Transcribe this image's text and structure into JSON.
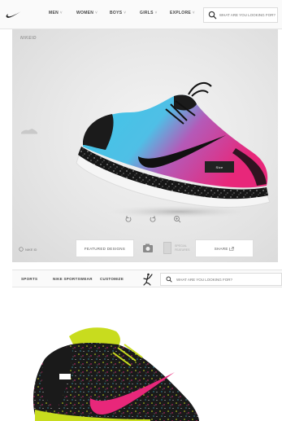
{
  "nav": {
    "items": [
      {
        "label": "MEN"
      },
      {
        "label": "WOMEN"
      },
      {
        "label": "BOYS"
      },
      {
        "label": "GIRLS"
      },
      {
        "label": "EXPLORE"
      }
    ],
    "search_placeholder": "WHAT ARE YOU LOOKING FOR?"
  },
  "stage": {
    "brand_label": "NIKEID",
    "size_button": "Size",
    "share_label": "NIKE ID",
    "buttons": {
      "featured": "FEATURED DESIGNS",
      "share": "SHARE"
    },
    "card_text": "SPECIAL FEATURES"
  },
  "subnav": {
    "items": [
      {
        "label": "SPORTS"
      },
      {
        "label": "NIKE SPORTSWEAR"
      },
      {
        "label": "CUSTOMIZE"
      }
    ],
    "search_placeholder": "WHAT ARE YOU LOOKING FOR?"
  },
  "colors": {
    "accent_cyan": "#3ec7e8",
    "accent_pink": "#e8277a",
    "accent_volt": "#c8dc1e",
    "shoe_black": "#1b1b1b"
  }
}
